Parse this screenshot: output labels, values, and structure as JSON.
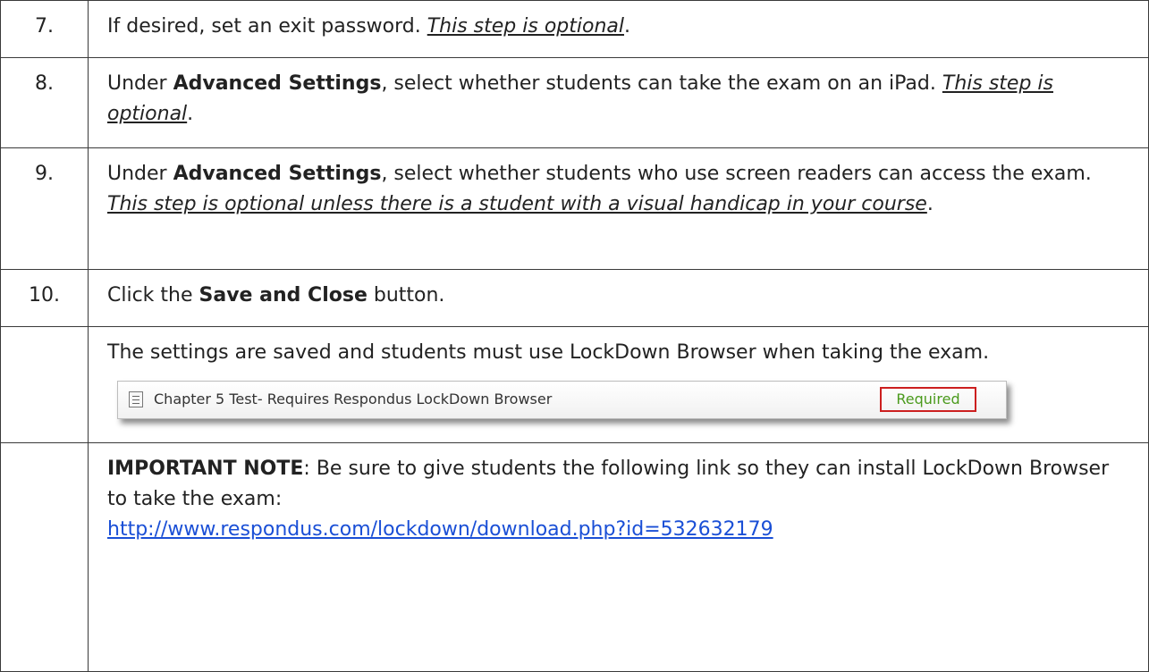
{
  "steps": [
    {
      "number": "7.",
      "text_before": "If desired, set an exit password. ",
      "optional": "This step is optional",
      "text_after": "."
    },
    {
      "number": "8.",
      "text_before": "Under ",
      "bold": "Advanced Settings",
      "text_middle": ", select whether students can take the exam on an iPad. ",
      "optional": "This step is optional",
      "text_after": "."
    },
    {
      "number": "9.",
      "text_before": "Under ",
      "bold": "Advanced Settings",
      "text_middle": ", select whether students who use screen readers can access the exam. ",
      "optional": "This step is optional unless there is a student with a visual handicap in your course",
      "text_after": "."
    },
    {
      "number": "10.",
      "text_before": "Click the ",
      "bold": "Save and Close",
      "text_after": " button."
    }
  ],
  "result": {
    "text": "The settings are saved and students must use LockDown Browser when taking the exam.",
    "screenshot": {
      "icon": "test-document-icon",
      "item_title": "Chapter 5 Test- Requires Respondus LockDown Browser",
      "status": "Required",
      "status_color": "#4a9a1c",
      "highlight_color": "#cc1f1f"
    }
  },
  "note": {
    "label": "IMPORTANT NOTE",
    "text": ": Be sure to give students the following link so they can install LockDown Browser to take the exam:",
    "link": "http://www.respondus.com/lockdown/download.php?id=532632179"
  }
}
